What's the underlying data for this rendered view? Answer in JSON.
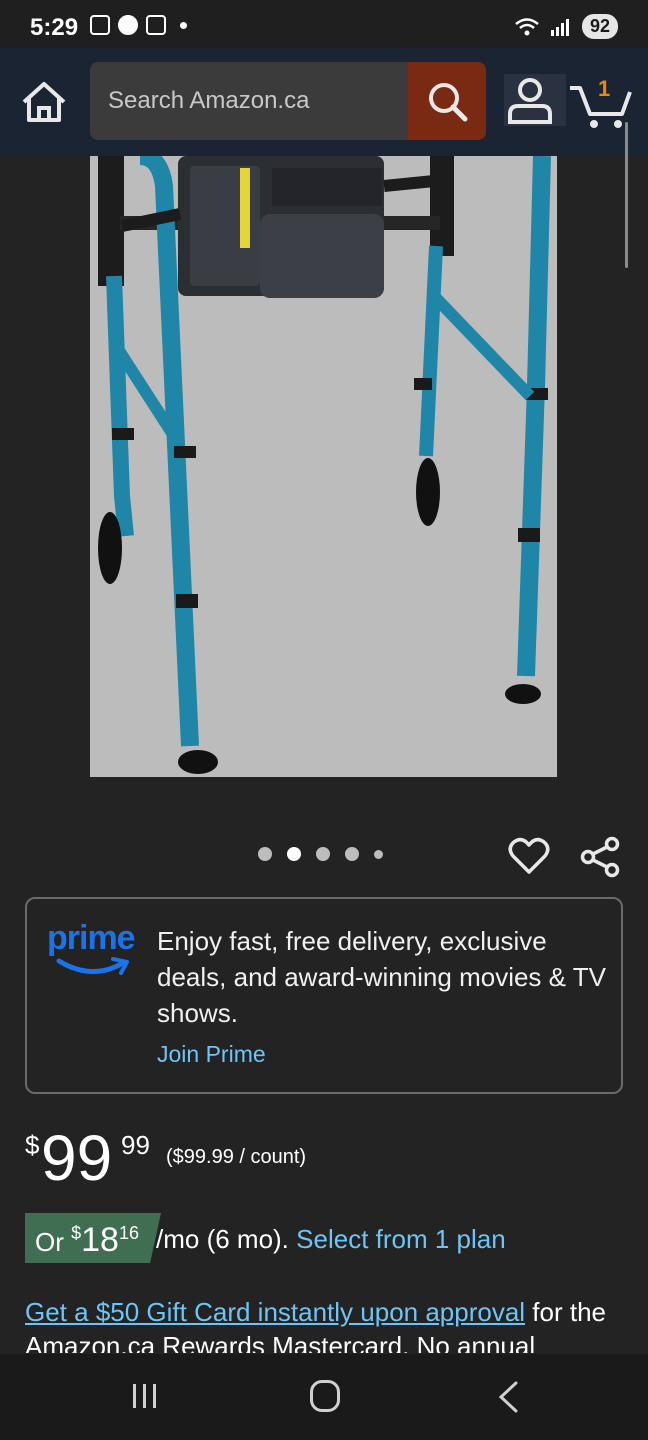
{
  "status_bar": {
    "time": "5:29",
    "battery": "92"
  },
  "header": {
    "search_placeholder": "Search Amazon.ca",
    "cart_count": "1"
  },
  "carousel": {
    "dot_count": 5,
    "active_index": 1
  },
  "prime": {
    "logo_text": "prime",
    "text": "Enjoy fast, free delivery, exclusive deals, and award-winning movies & TV shows.",
    "link": "Join Prime"
  },
  "price": {
    "symbol": "$",
    "whole": "99",
    "fraction": "99",
    "unit_price": "($99.99 / count)"
  },
  "monthly": {
    "prefix": "Or ",
    "symbol": "$",
    "whole": "18",
    "fraction": "16",
    "suffix": "/mo (6 mo).",
    "plan_link": "Select from 1 plan"
  },
  "gift_card": {
    "link": "Get a $50 Gift Card instantly upon approval",
    "text": " for the Amazon.ca Rewards Mastercard. No annual"
  },
  "colors": {
    "header_bg": "#1b2433",
    "search_btn": "#7a2a12",
    "cart_count": "#f08804",
    "link": "#6ec5f5",
    "prime_blue": "#1a73e8",
    "monthly_badge": "#3f6e53",
    "walker_frame": "#1f86a8"
  }
}
